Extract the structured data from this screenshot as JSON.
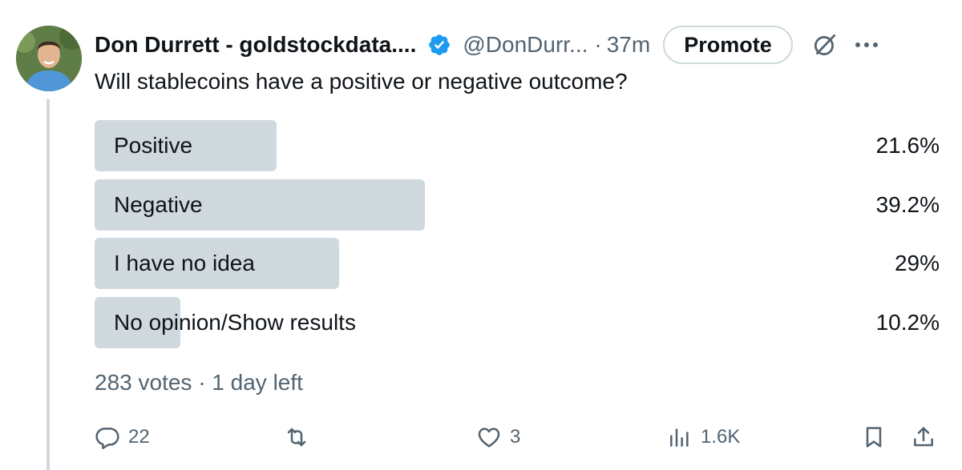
{
  "tweet": {
    "author_name": "Don Durrett - goldstockdata....",
    "handle": "@DonDurr...",
    "separator": "·",
    "time": "37m",
    "promote_label": "Promote",
    "text": "Will stablecoins have a positive or negative outcome?"
  },
  "poll": {
    "options": [
      {
        "label": "Positive",
        "percent_text": "21.6%",
        "percent": 21.6
      },
      {
        "label": "Negative",
        "percent_text": "39.2%",
        "percent": 39.2
      },
      {
        "label": "I have no idea",
        "percent_text": "29%",
        "percent": 29
      },
      {
        "label": "No opinion/Show results",
        "percent_text": "10.2%",
        "percent": 10.2
      }
    ],
    "meta": "283 votes · 1 day left"
  },
  "actions": {
    "replies": "22",
    "reposts": "",
    "likes": "3",
    "views": "1.6K"
  },
  "colors": {
    "verified": "#1d9bf0",
    "bar": "#cfd9de",
    "muted": "#536471",
    "text": "#0f1419"
  },
  "icons": [
    "verified-badge-icon",
    "grok-icon",
    "more-icon",
    "reply-icon",
    "repost-icon",
    "like-icon",
    "views-icon",
    "bookmark-icon",
    "share-icon"
  ]
}
